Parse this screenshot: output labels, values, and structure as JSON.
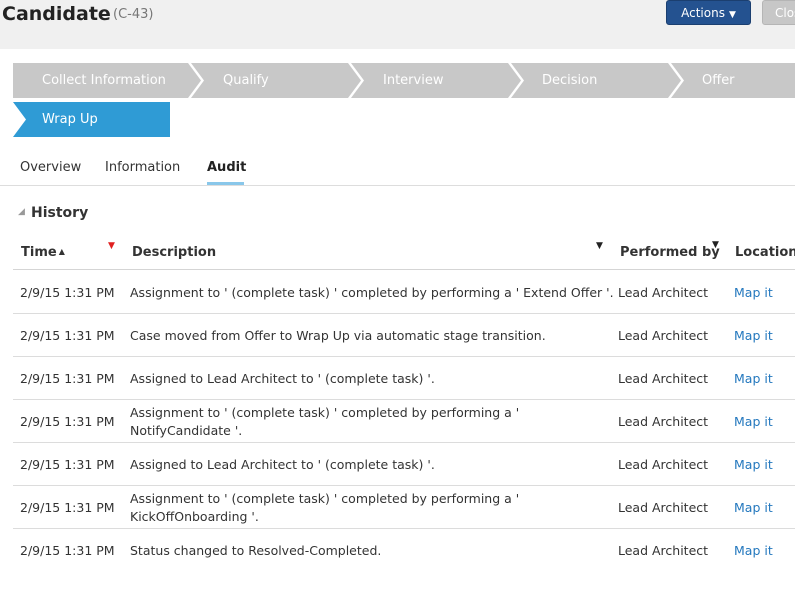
{
  "header": {
    "title": "Candidate",
    "case_id": "(C-43)",
    "actions_label": "Actions",
    "close_label": "Close",
    "actions_color": "#245290"
  },
  "stages": {
    "items": [
      {
        "label": "Collect Information",
        "state": "inactive"
      },
      {
        "label": "Qualify",
        "state": "inactive"
      },
      {
        "label": "Interview",
        "state": "inactive"
      },
      {
        "label": "Decision",
        "state": "inactive"
      },
      {
        "label": "Offer",
        "state": "inactive"
      },
      {
        "label": "Wrap Up",
        "state": "current"
      }
    ],
    "current_color": "#2f9bd5",
    "inactive_color": "#c8c8c8"
  },
  "tabs": {
    "items": [
      {
        "label": "Overview"
      },
      {
        "label": "Information"
      },
      {
        "label": "Audit"
      }
    ],
    "active": "Audit"
  },
  "history": {
    "title": "History",
    "columns": [
      {
        "label": "Time",
        "sorted": "ascending",
        "filtered": true
      },
      {
        "label": "Description",
        "filtered": false
      },
      {
        "label": "Performed by",
        "filtered": false
      },
      {
        "label": "Location"
      }
    ],
    "rows": [
      {
        "time": "2/9/15 1:31 PM",
        "description": "Assignment to ' (complete task) ' completed by performing a ' Extend Offer '.",
        "performed_by": "Lead Architect",
        "location": "Map it"
      },
      {
        "time": "2/9/15 1:31 PM",
        "description": "Case moved from Offer to Wrap Up via automatic stage transition.",
        "performed_by": "Lead Architect",
        "location": "Map it"
      },
      {
        "time": "2/9/15 1:31 PM",
        "description": "Assigned to Lead Architect to ' (complete task) '.",
        "performed_by": "Lead Architect",
        "location": "Map it"
      },
      {
        "time": "2/9/15 1:31 PM",
        "description": "Assignment to ' (complete task) ' completed by performing a ' NotifyCandidate '.",
        "performed_by": "Lead Architect",
        "location": "Map it"
      },
      {
        "time": "2/9/15 1:31 PM",
        "description": "Assigned to Lead Architect to ' (complete task) '.",
        "performed_by": "Lead Architect",
        "location": "Map it"
      },
      {
        "time": "2/9/15 1:31 PM",
        "description": "Assignment to ' (complete task) ' completed by performing a ' KickOffOnboarding '.",
        "performed_by": "Lead Architect",
        "location": "Map it"
      },
      {
        "time": "2/9/15 1:31 PM",
        "description": "Status changed to Resolved-Completed.",
        "performed_by": "Lead Architect",
        "location": "Map it"
      }
    ],
    "link_color": "#2478be",
    "filter_active_color": "#e02020"
  }
}
